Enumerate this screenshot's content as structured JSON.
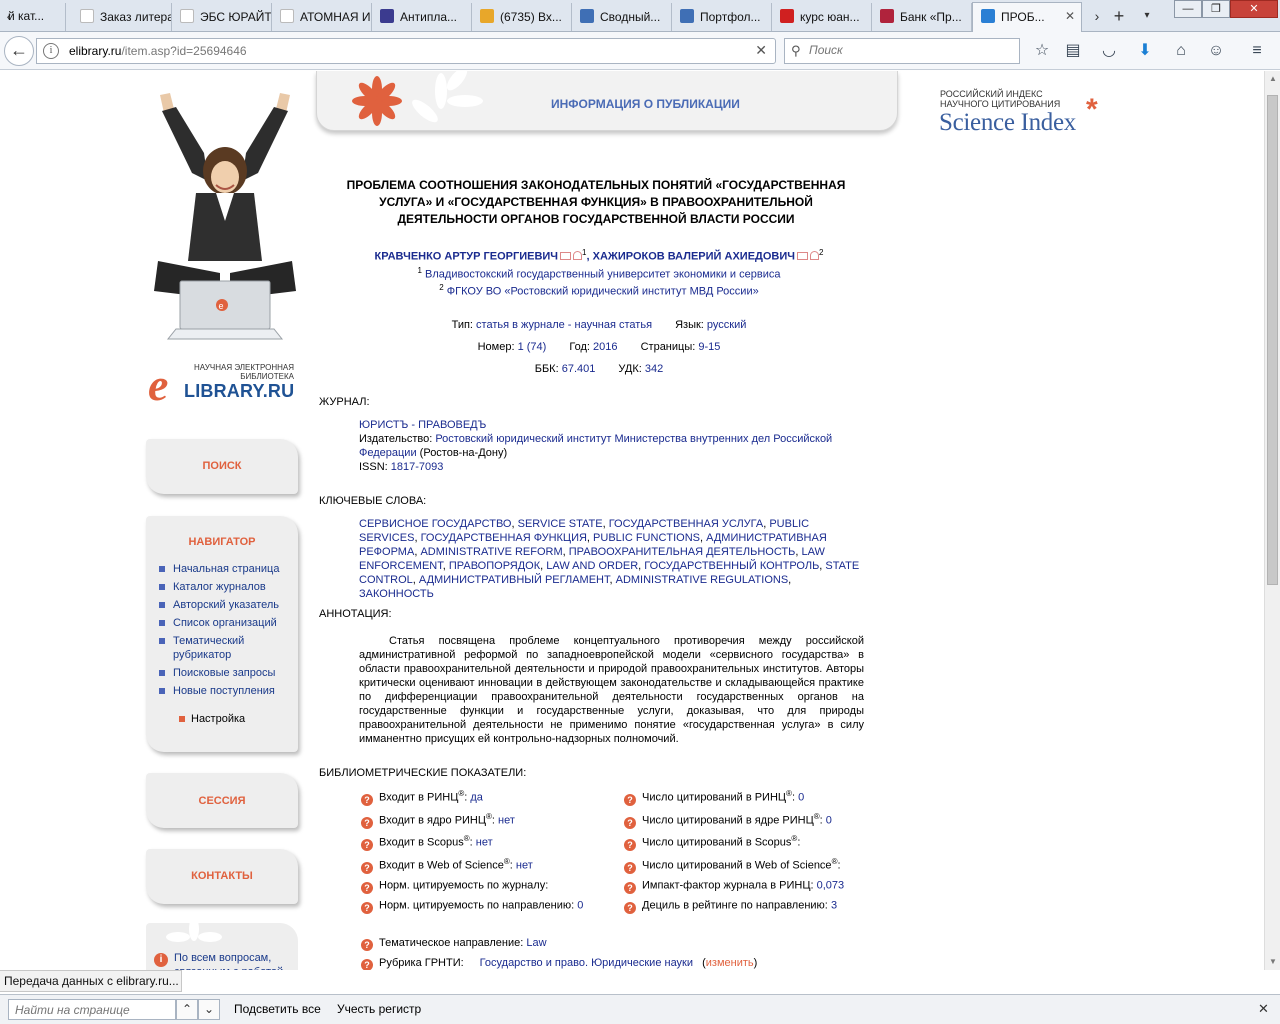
{
  "browser": {
    "tabs": [
      {
        "label": "й кат...",
        "color": "#7a8797"
      },
      {
        "label": "Заказ литера...",
        "color": "#ffffff"
      },
      {
        "label": "ЭБС ЮРАЙТ",
        "color": "#ffffff"
      },
      {
        "label": "АТОМНАЯ И...",
        "color": "#ffffff"
      },
      {
        "label": "Антипла...",
        "color": "#3b3b8f"
      },
      {
        "label": "(6735) Вх...",
        "color": "#e8a72a"
      },
      {
        "label": "Сводный...",
        "color": "#3f6fb5"
      },
      {
        "label": "Портфол...",
        "color": "#3f6fb5"
      },
      {
        "label": "курс юан...",
        "color": "#d02020"
      },
      {
        "label": "Банк «Пр...",
        "color": "#b0233c"
      },
      {
        "label": "ПРОБ...",
        "color": "#2a7fd4"
      }
    ],
    "url_host": "elibrary.ru",
    "url_path": "/item.asp?id=25694646",
    "search_placeholder": "Поиск",
    "status_text": "Передача данных с elibrary.ru...",
    "find_placeholder": "Найти на странице",
    "find_highlight_all": "Подсветить все",
    "find_match_case": "Учесть регистр"
  },
  "sidebar": {
    "logo_small": "НАУЧНАЯ ЭЛЕКТРОННАЯ БИБЛИОТЕКА",
    "logo_big": "LIBRARY.RU",
    "logo_letter": "e",
    "search_label": "ПОИСК",
    "navigator_title": "НАВИГАТОР",
    "nav_items": [
      "Начальная страница",
      "Каталог журналов",
      "Авторский указатель",
      "Список организаций",
      "Тематический рубрикатор",
      "Поисковые запросы",
      "Новые поступления"
    ],
    "settings_label": "Настройка",
    "session_label": "СЕССИЯ",
    "contacts_label": "КОНТАКТЫ",
    "info_text": "По всем вопросам, связанным с работой"
  },
  "header": {
    "banner_title": "ИНФОРМАЦИЯ О ПУБЛИКАЦИИ",
    "si_small_1": "РОССИЙСКИЙ ИНДЕКС",
    "si_small_2": "НАУЧНОГО ЦИТИРОВАНИЯ",
    "si_big": "Science Index",
    "si_asterisk": "*"
  },
  "article": {
    "title": "ПРОБЛЕМА СООТНОШЕНИЯ ЗАКОНОДАТЕЛЬНЫХ ПОНЯТИЙ «ГОСУДАРСТВЕННАЯ УСЛУГА» И «ГОСУДАРСТВЕННАЯ ФУНКЦИЯ» В ПРАВООХРАНИТЕЛЬНОЙ ДЕЯТЕЛЬНОСТИ ОРГАНОВ ГОСУДАРСТВЕННОЙ ВЛАСТИ РОССИИ",
    "author1": "КРАВЧЕНКО АРТУР ГЕОРГИЕВИЧ",
    "author1_sup": "1",
    "author2": "ХАЖИРОКОВ ВАЛЕРИЙ АХИЕДОВИЧ",
    "author2_sup": "2",
    "aff1_sup": "1",
    "aff1": "Владивостокский государственный университет экономики и сервиса",
    "aff2_sup": "2",
    "aff2": "ФГКОУ ВО «Ростовский юридический институт МВД России»",
    "type_label": "Тип:",
    "type_value": "статья в журнале - научная статья",
    "lang_label": "Язык:",
    "lang_value": "русский",
    "issue_label": "Номер:",
    "issue_value": "1 (74)",
    "year_label": "Год:",
    "year_value": "2016",
    "pages_label": "Страницы:",
    "pages_value": "9-15",
    "bbk_label": "ББК:",
    "bbk_value": "67.401",
    "udk_label": "УДК:",
    "udk_value": "342",
    "journal_heading": "ЖУРНАЛ:",
    "journal_name": "ЮРИСТЪ - ПРАВОВЕДЪ",
    "publisher_label": "Издательство:",
    "publisher_value": "Ростовский юридический институт Министерства внутренних дел Российской Федерации",
    "publisher_city": "(Ростов-на-Дону)",
    "issn_label": "ISSN:",
    "issn_value": "1817-7093",
    "keywords_heading": "КЛЮЧЕВЫЕ СЛОВА:",
    "keywords": [
      "СЕРВИСНОЕ ГОСУДАРСТВО",
      "SERVICE STATE",
      "ГОСУДАРСТВЕННАЯ УСЛУГА",
      "PUBLIC SERVICES",
      "ГОСУДАРСТВЕННАЯ ФУНКЦИЯ",
      "PUBLIC FUNCTIONS",
      "АДМИНИСТРАТИВНАЯ РЕФОРМА",
      "ADMINISTRATIVE REFORM",
      "ПРАВООХРАНИТЕЛЬНАЯ ДЕЯТЕЛЬНОСТЬ",
      "LAW ENFORCEMENT",
      "ПРАВОПОРЯДОК",
      "LAW AND ORDER",
      "ГОСУДАРСТВЕННЫЙ КОНТРОЛЬ",
      "STATE CONTROL",
      "АДМИНИСТРАТИВНЫЙ РЕГЛАМЕНТ",
      "ADMINISTRATIVE REGULATIONS",
      "ЗАКОННОСТЬ"
    ],
    "abstract_heading": "АННОТАЦИЯ:",
    "abstract": "Статья посвящена проблеме концептуального противоречия между российской административной реформой по западноевропейской модели «сервисного государства» в области правоохранительной деятельности и природой правоохранительных институтов. Авторы критически оценивают инновации в действующем законодательстве и складывающейся практике по дифференциации правоохранительной деятельности государственных органов на государственные функции и государственные услуги, доказывая, что для природы правоохранительной деятельности не применимо понятие «государственная услуга» в силу имманентно присущих ей контрольно-надзорных полномочий.",
    "biblio_heading": "БИБЛИОМЕТРИЧЕСКИЕ ПОКАЗАТЕЛИ:",
    "biblio_left": [
      {
        "label": "Входит в РИНЦ",
        "sup": "®",
        "colon": ":",
        "value": "да"
      },
      {
        "label": "Входит в ядро РИНЦ",
        "sup": "®",
        "colon": ":",
        "value": "нет"
      },
      {
        "label": "Входит в Scopus",
        "sup": "®",
        "colon": ":",
        "value": "нет"
      },
      {
        "label": "Входит в Web of Science",
        "sup": "®",
        "colon": ":",
        "value": "нет"
      },
      {
        "label": "Норм. цитируемость по журналу:",
        "sup": "",
        "colon": "",
        "value": ""
      },
      {
        "label": "Норм. цитируемость по направлению:",
        "sup": "",
        "colon": "",
        "value": "0"
      }
    ],
    "biblio_right": [
      {
        "label": "Число цитирований в РИНЦ",
        "sup": "®",
        "colon": ":",
        "value": "0"
      },
      {
        "label": "Число цитирований в ядре РИНЦ",
        "sup": "®",
        "colon": ":",
        "value": "0"
      },
      {
        "label": "Число цитирований в Scopus",
        "sup": "®",
        "colon": ":",
        "value": ""
      },
      {
        "label": "Число цитирований в Web of Science",
        "sup": "®",
        "colon": ":",
        "value": ""
      },
      {
        "label": "Импакт-фактор журнала в РИНЦ:",
        "sup": "",
        "colon": "",
        "value": "0,073"
      },
      {
        "label": "Дециль в рейтинге по направлению:",
        "sup": "",
        "colon": "",
        "value": "3"
      }
    ],
    "topic_label": "Тематическое направление:",
    "topic_value": "Law",
    "grnti_label": "Рубрика ГРНТИ:",
    "grnti_value": "Государство и право. Юридические науки",
    "grnti_change": "изменить"
  },
  "colors": {
    "accent": "#e0613e",
    "link": "#1a2b8f",
    "banner_title": "#4a6bb5",
    "logo_blue": "#1f5294"
  }
}
